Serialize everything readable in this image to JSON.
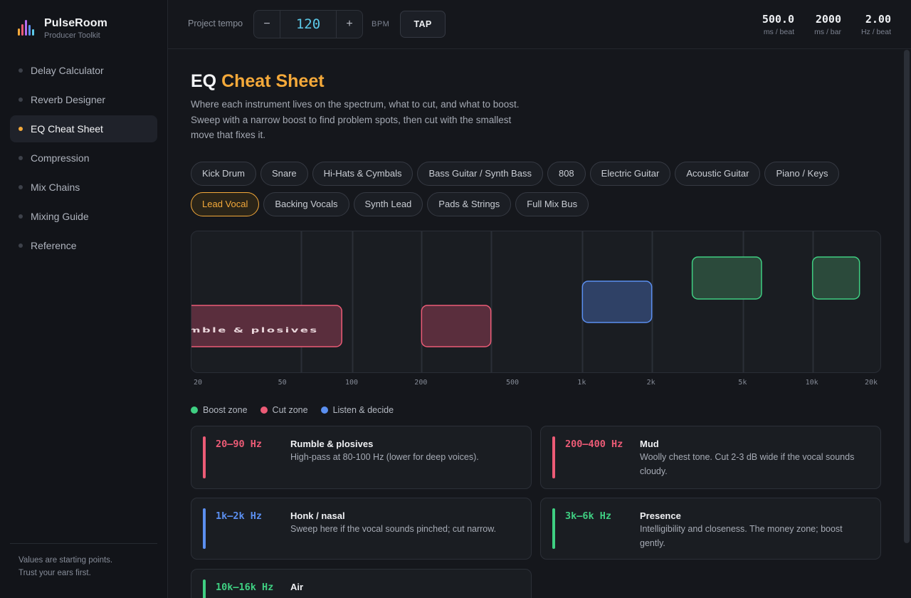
{
  "app": {
    "name": "PulseRoom",
    "subtitle": "Producer Toolkit"
  },
  "sidebar": {
    "items": [
      {
        "label": "Delay Calculator",
        "active": false
      },
      {
        "label": "Reverb Designer",
        "active": false
      },
      {
        "label": "EQ Cheat Sheet",
        "active": true
      },
      {
        "label": "Compression",
        "active": false
      },
      {
        "label": "Mix Chains",
        "active": false
      },
      {
        "label": "Mixing Guide",
        "active": false
      },
      {
        "label": "Reference",
        "active": false
      }
    ],
    "footer_line1": "Values are starting points.",
    "footer_line2": "Trust your ears first."
  },
  "topbar": {
    "tempo_label": "Project tempo",
    "decrement": "−",
    "tempo_value": "120",
    "increment": "+",
    "bpm_unit": "BPM",
    "tap_label": "TAP",
    "stats": [
      {
        "value": "500.0",
        "unit": "ms / beat"
      },
      {
        "value": "2000",
        "unit": "ms / bar"
      },
      {
        "value": "2.00",
        "unit": "Hz / beat"
      }
    ]
  },
  "page": {
    "title_main": "EQ",
    "title_accent": "Cheat Sheet",
    "description": "Where each instrument lives on the spectrum, what to cut, and what to boost. Sweep with a narrow boost to find problem spots, then cut with the smallest move that fixes it."
  },
  "instruments": [
    {
      "label": "Kick Drum",
      "active": false
    },
    {
      "label": "Snare",
      "active": false
    },
    {
      "label": "Hi-Hats & Cymbals",
      "active": false
    },
    {
      "label": "Bass Guitar / Synth Bass",
      "active": false
    },
    {
      "label": "808",
      "active": false
    },
    {
      "label": "Electric Guitar",
      "active": false
    },
    {
      "label": "Acoustic Guitar",
      "active": false
    },
    {
      "label": "Piano / Keys",
      "active": false
    },
    {
      "label": "Lead Vocal",
      "active": true
    },
    {
      "label": "Backing Vocals",
      "active": false
    },
    {
      "label": "Synth Lead",
      "active": false
    },
    {
      "label": "Pads & Strings",
      "active": false
    },
    {
      "label": "Full Mix Bus",
      "active": false
    }
  ],
  "spectrum": {
    "freq_min_hz": 20,
    "freq_max_hz": 20000,
    "tick_labels": [
      "20",
      "50",
      "100",
      "200",
      "500",
      "1k",
      "2k",
      "5k",
      "10k",
      "20k"
    ],
    "tick_values_hz": [
      20,
      50,
      100,
      200,
      500,
      1000,
      2000,
      5000,
      10000,
      20000
    ],
    "overflow_label": "Rumble & plosives",
    "zones": [
      {
        "type": "cut",
        "lo_hz": 20,
        "hi_hz": 90,
        "level": "low"
      },
      {
        "type": "cut",
        "lo_hz": 200,
        "hi_hz": 400,
        "level": "low"
      },
      {
        "type": "listen",
        "lo_hz": 1000,
        "hi_hz": 2000,
        "level": "mid"
      },
      {
        "type": "boost",
        "lo_hz": 3000,
        "hi_hz": 6000,
        "level": "high"
      },
      {
        "type": "boost",
        "lo_hz": 10000,
        "hi_hz": 16000,
        "level": "high"
      }
    ]
  },
  "legend": [
    {
      "label": "Boost zone",
      "color": "#3fcf82"
    },
    {
      "label": "Cut zone",
      "color": "#ec5b76"
    },
    {
      "label": "Listen & decide",
      "color": "#5b8ff0"
    }
  ],
  "colors": {
    "boost": "#3fcf82",
    "cut": "#ec5b76",
    "listen": "#5b8ff0",
    "accent": "#f4a93a",
    "tempo": "#5cc9e8"
  },
  "cards": [
    {
      "range": "20–90 Hz",
      "type": "cut",
      "name": "Rumble & plosives",
      "text": "High-pass at 80-100 Hz (lower for deep voices)."
    },
    {
      "range": "200–400 Hz",
      "type": "cut",
      "name": "Mud",
      "text": "Woolly chest tone. Cut 2-3 dB wide if the vocal sounds cloudy."
    },
    {
      "range": "1k–2k Hz",
      "type": "listen",
      "name": "Honk / nasal",
      "text": "Sweep here if the vocal sounds pinched; cut narrow."
    },
    {
      "range": "3k–6k Hz",
      "type": "boost",
      "name": "Presence",
      "text": "Intelligibility and closeness. The money zone; boost gently."
    },
    {
      "range": "10k–16k Hz",
      "type": "boost",
      "name": "Air",
      "text": ""
    }
  ]
}
